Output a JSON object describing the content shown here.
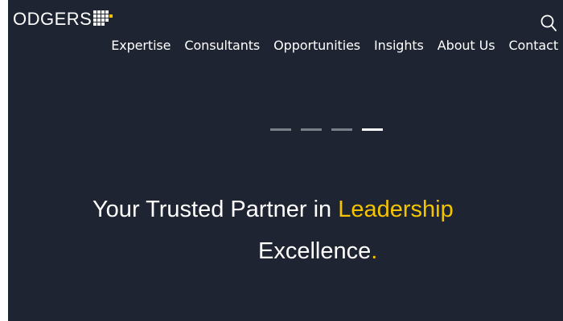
{
  "brand": {
    "logo_text": "ODGERS",
    "accent_color": "#f5c400",
    "background_color": "#1e2431"
  },
  "header": {
    "search_icon": "search-icon",
    "nav": [
      {
        "label": "Expertise"
      },
      {
        "label": "Consultants"
      },
      {
        "label": "Opportunities"
      },
      {
        "label": "Insights"
      },
      {
        "label": "About Us"
      },
      {
        "label": "Contact"
      }
    ]
  },
  "hero": {
    "slides_total": 4,
    "active_slide": 4,
    "headline_part1": "Your Trusted Partner in ",
    "headline_accent": "Leadership",
    "headline_part2": "Excellence",
    "headline_period": "."
  }
}
